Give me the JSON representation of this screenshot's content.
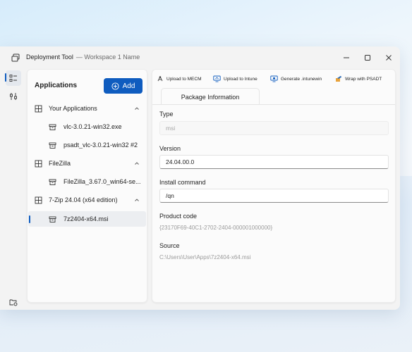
{
  "window": {
    "title": "Deployment Tool",
    "subtitle": "— Workspace 1 Name"
  },
  "rail": {
    "items": [
      {
        "name": "applications-list-icon"
      },
      {
        "name": "tools-icon"
      },
      {
        "name": "folder-settings-icon"
      },
      {
        "name": "folder-icon"
      }
    ]
  },
  "applications": {
    "title": "Applications",
    "add_label": "Add",
    "groups": [
      {
        "label": "Your Applications",
        "items": [
          "vlc-3.0.21-win32.exe",
          "psadt_vlc-3.0.21-win32 #2"
        ]
      },
      {
        "label": "FileZilla",
        "items": [
          "FileZilla_3.67.0_win64-se..."
        ]
      },
      {
        "label": "7-Zip 24.04 (x64 edition)",
        "items": [
          "7z2404-x64.msi"
        ]
      }
    ]
  },
  "toolbar": {
    "upload_mecm": "Upload to MECM",
    "upload_intune": "Upload to Intune",
    "generate_intunewin": "Generate .intunewin",
    "wrap_psadt": "Wrap with PSADT"
  },
  "details": {
    "tab_label": "Package Information",
    "type_label": "Type",
    "type_value": "msi",
    "version_label": "Version",
    "version_value": "24.04.00.0",
    "install_label": "Install command",
    "install_value": "/qn",
    "product_code_label": "Product code",
    "product_code_value": "{23170F69-40C1-2702-2404-000001000000}",
    "source_label": "Source",
    "source_value": "C:\\Users\\User\\Apps\\7z2404-x64.msi"
  },
  "colors": {
    "accent": "#0f5cbf",
    "window_bg": "#f3f3f3",
    "panel_bg": "#fbfbfb"
  }
}
